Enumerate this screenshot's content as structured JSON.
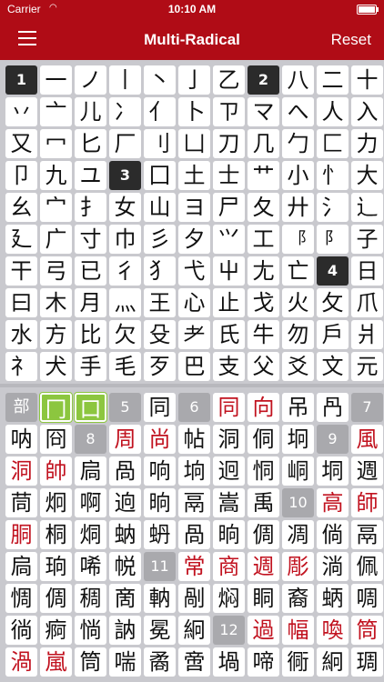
{
  "status_bar": {
    "carrier": "Carrier",
    "time": "10:10 AM"
  },
  "nav": {
    "title": "Multi-Radical",
    "reset": "Reset"
  },
  "radicals": [
    {
      "t": "1",
      "k": "stroke"
    },
    {
      "t": "一"
    },
    {
      "t": "ノ"
    },
    {
      "t": "丨"
    },
    {
      "t": "丶"
    },
    {
      "t": "亅"
    },
    {
      "t": "乙"
    },
    {
      "t": "2",
      "k": "stroke"
    },
    {
      "t": "八"
    },
    {
      "t": "二"
    },
    {
      "t": "十"
    },
    {
      "t": "丷"
    },
    {
      "t": "亠"
    },
    {
      "t": "儿"
    },
    {
      "t": "冫"
    },
    {
      "t": "亻"
    },
    {
      "t": "卜"
    },
    {
      "t": "ㄗ"
    },
    {
      "t": "マ"
    },
    {
      "t": "へ"
    },
    {
      "t": "人"
    },
    {
      "t": "入"
    },
    {
      "t": "又"
    },
    {
      "t": "冖"
    },
    {
      "t": "匕"
    },
    {
      "t": "厂"
    },
    {
      "t": "刂"
    },
    {
      "t": "凵"
    },
    {
      "t": "刀"
    },
    {
      "t": "几"
    },
    {
      "t": "勹"
    },
    {
      "t": "匚"
    },
    {
      "t": "力"
    },
    {
      "t": "卩"
    },
    {
      "t": "九"
    },
    {
      "t": "ユ"
    },
    {
      "t": "3",
      "k": "stroke"
    },
    {
      "t": "囗"
    },
    {
      "t": "土"
    },
    {
      "t": "士"
    },
    {
      "t": "艹"
    },
    {
      "t": "小"
    },
    {
      "t": "忄"
    },
    {
      "t": "大"
    },
    {
      "t": "幺"
    },
    {
      "t": "宀"
    },
    {
      "t": "扌"
    },
    {
      "t": "女"
    },
    {
      "t": "山"
    },
    {
      "t": "ヨ"
    },
    {
      "t": "尸"
    },
    {
      "t": "夂"
    },
    {
      "t": "廾"
    },
    {
      "t": "氵"
    },
    {
      "t": "辶"
    },
    {
      "t": "廴"
    },
    {
      "t": "广"
    },
    {
      "t": "寸"
    },
    {
      "t": "巾"
    },
    {
      "t": "彡"
    },
    {
      "t": "夕"
    },
    {
      "t": "⺍"
    },
    {
      "t": "工"
    },
    {
      "t": "⻏",
      "k": "small"
    },
    {
      "t": "阝",
      "k": "small"
    },
    {
      "t": "子"
    },
    {
      "t": "干"
    },
    {
      "t": "弓"
    },
    {
      "t": "已"
    },
    {
      "t": "彳"
    },
    {
      "t": "犭"
    },
    {
      "t": "弋"
    },
    {
      "t": "屮"
    },
    {
      "t": "尢"
    },
    {
      "t": "亡"
    },
    {
      "t": "4",
      "k": "stroke"
    },
    {
      "t": "日"
    },
    {
      "t": "曰"
    },
    {
      "t": "木"
    },
    {
      "t": "月"
    },
    {
      "t": "灬"
    },
    {
      "t": "王"
    },
    {
      "t": "心"
    },
    {
      "t": "止"
    },
    {
      "t": "戈"
    },
    {
      "t": "火"
    },
    {
      "t": "攵"
    },
    {
      "t": "爪"
    },
    {
      "t": "水"
    },
    {
      "t": "方"
    },
    {
      "t": "比"
    },
    {
      "t": "欠"
    },
    {
      "t": "殳"
    },
    {
      "t": "耂"
    },
    {
      "t": "氏"
    },
    {
      "t": "牛"
    },
    {
      "t": "勿"
    },
    {
      "t": "戶"
    },
    {
      "t": "爿"
    },
    {
      "t": "礻"
    },
    {
      "t": "犬"
    },
    {
      "t": "手"
    },
    {
      "t": "毛"
    },
    {
      "t": "歹"
    },
    {
      "t": "巴"
    },
    {
      "t": "支"
    },
    {
      "t": "父"
    },
    {
      "t": "爻"
    },
    {
      "t": "文"
    },
    {
      "t": "元"
    }
  ],
  "results": [
    {
      "t": "部",
      "k": "bu"
    },
    {
      "t": "冂",
      "k": "sel"
    },
    {
      "t": "口",
      "k": "sel"
    },
    {
      "t": "5",
      "k": "stroke"
    },
    {
      "t": "同"
    },
    {
      "t": "6",
      "k": "stroke"
    },
    {
      "t": "同",
      "k": "red"
    },
    {
      "t": "向",
      "k": "red"
    },
    {
      "t": "吊"
    },
    {
      "t": "冎"
    },
    {
      "t": "7",
      "k": "stroke"
    },
    {
      "t": "呐"
    },
    {
      "t": "冏"
    },
    {
      "t": "8",
      "k": "stroke"
    },
    {
      "t": "周",
      "k": "red"
    },
    {
      "t": "尚",
      "k": "red"
    },
    {
      "t": "帖"
    },
    {
      "t": "洞"
    },
    {
      "t": "侗"
    },
    {
      "t": "坰"
    },
    {
      "t": "9",
      "k": "stroke"
    },
    {
      "t": "風",
      "k": "red"
    },
    {
      "t": "洞",
      "k": "red"
    },
    {
      "t": "帥",
      "k": "red"
    },
    {
      "t": "扃"
    },
    {
      "t": "咼"
    },
    {
      "t": "响"
    },
    {
      "t": "垧"
    },
    {
      "t": "迥"
    },
    {
      "t": "恫"
    },
    {
      "t": "峒"
    },
    {
      "t": "垌"
    },
    {
      "t": "週"
    },
    {
      "t": "茼"
    },
    {
      "t": "炯"
    },
    {
      "t": "啊"
    },
    {
      "t": "逈"
    },
    {
      "t": "晌"
    },
    {
      "t": "鬲"
    },
    {
      "t": "嵩"
    },
    {
      "t": "禹"
    },
    {
      "t": "10",
      "k": "stroke"
    },
    {
      "t": "高",
      "k": "red"
    },
    {
      "t": "師",
      "k": "red"
    },
    {
      "t": "胴",
      "k": "red"
    },
    {
      "t": "桐"
    },
    {
      "t": "烔"
    },
    {
      "t": "蚋"
    },
    {
      "t": "蚒"
    },
    {
      "t": "咼"
    },
    {
      "t": "晌"
    },
    {
      "t": "倜"
    },
    {
      "t": "凋"
    },
    {
      "t": "倘"
    },
    {
      "t": "鬲"
    },
    {
      "t": "扃"
    },
    {
      "t": "珦"
    },
    {
      "t": "唏"
    },
    {
      "t": "帨"
    },
    {
      "t": "11",
      "k": "stroke"
    },
    {
      "t": "常",
      "k": "red"
    },
    {
      "t": "商",
      "k": "red"
    },
    {
      "t": "週",
      "k": "red"
    },
    {
      "t": "彫",
      "k": "red"
    },
    {
      "t": "淌"
    },
    {
      "t": "佩"
    },
    {
      "t": "惆"
    },
    {
      "t": "倜"
    },
    {
      "t": "稠"
    },
    {
      "t": "啇"
    },
    {
      "t": "軜"
    },
    {
      "t": "剮"
    },
    {
      "t": "焖"
    },
    {
      "t": "眮"
    },
    {
      "t": "裔"
    },
    {
      "t": "蛃"
    },
    {
      "t": "啁"
    },
    {
      "t": "徜"
    },
    {
      "t": "痾"
    },
    {
      "t": "惝"
    },
    {
      "t": "訥"
    },
    {
      "t": "冕"
    },
    {
      "t": "絅"
    },
    {
      "t": "12",
      "k": "stroke"
    },
    {
      "t": "過",
      "k": "red"
    },
    {
      "t": "幅",
      "k": "red"
    },
    {
      "t": "喚",
      "k": "red"
    },
    {
      "t": "筒",
      "k": "red"
    },
    {
      "t": "渦",
      "k": "red"
    },
    {
      "t": "嵐",
      "k": "red"
    },
    {
      "t": "筒"
    },
    {
      "t": "喘"
    },
    {
      "t": "矞"
    },
    {
      "t": "啻"
    },
    {
      "t": "堝"
    },
    {
      "t": "啼"
    },
    {
      "t": "衕"
    },
    {
      "t": "絅"
    },
    {
      "t": "琱"
    }
  ]
}
